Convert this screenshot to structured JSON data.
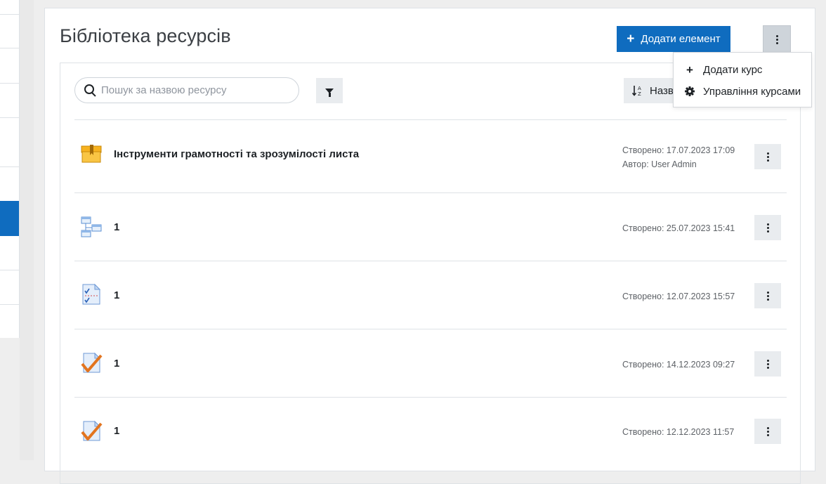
{
  "page": {
    "title": "Бібліотека ресурсів",
    "add_button_label": "Додати елемент",
    "menu_icon": "kebab-menu-icon"
  },
  "toolbar": {
    "search_placeholder": "Пошук за назвою ресурсу",
    "search_value": "",
    "sort_label": "Назва",
    "filter_icon": "filter-icon",
    "sort_icon": "sort-alpha-icon"
  },
  "dropdown": {
    "items": [
      {
        "label": "Додати курс",
        "icon": "plus-icon"
      },
      {
        "label": "Управління курсами",
        "icon": "gear-icon"
      }
    ]
  },
  "resources": [
    {
      "title": "Інструменти грамотності та зрозумілості листа",
      "created": "Створено: 17.07.2023 17:09",
      "author": "Автор: User Admin",
      "icon": "course-box-icon"
    },
    {
      "title": "1",
      "created": "Створено: 25.07.2023 15:41",
      "author": "",
      "icon": "structure-diagram-icon"
    },
    {
      "title": "1",
      "created": "Створено: 12.07.2023 15:57",
      "author": "",
      "icon": "checklist-document-icon"
    },
    {
      "title": "1",
      "created": "Створено: 14.12.2023 09:27",
      "author": "",
      "icon": "quiz-check-icon"
    },
    {
      "title": "1",
      "created": "Створено: 12.12.2023 11:57",
      "author": "",
      "icon": "quiz-check-icon"
    }
  ],
  "colors": {
    "primary": "#0f6cbf",
    "button_gray": "#e9ecef",
    "text": "#1d2125",
    "muted": "#5d6166"
  }
}
